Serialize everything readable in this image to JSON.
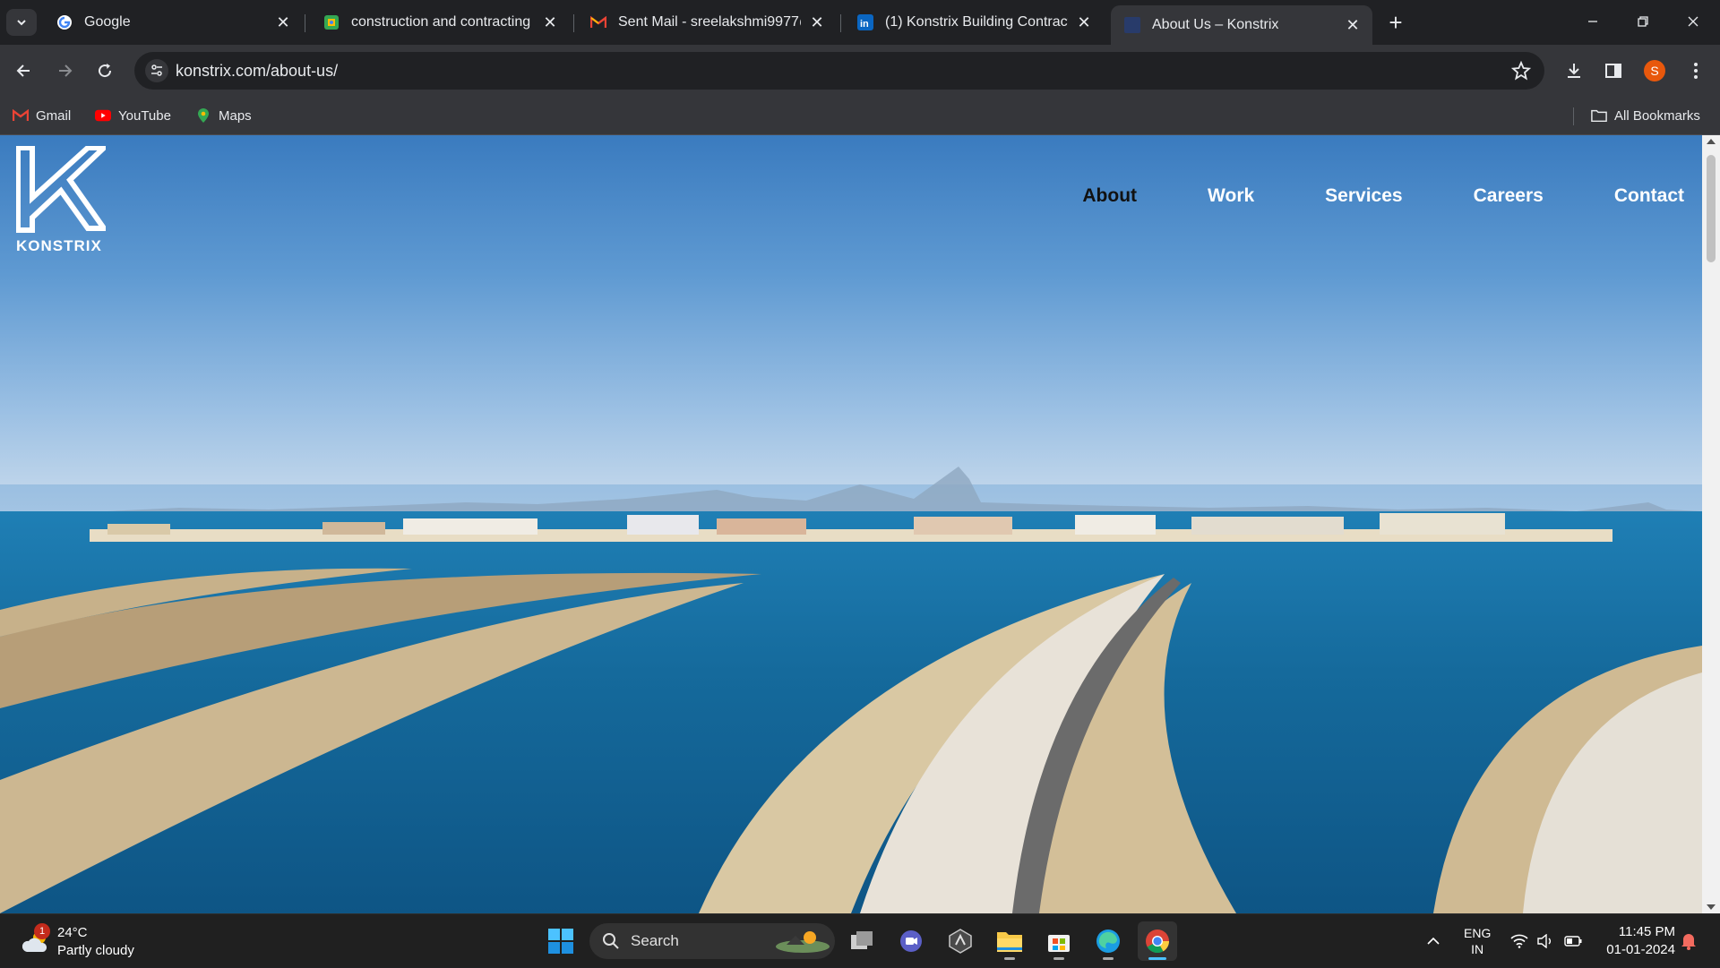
{
  "browser": {
    "tabs": [
      {
        "title": "Google",
        "icon": "google-icon"
      },
      {
        "title": "construction and contracting co",
        "icon": "maps-favicon-icon"
      },
      {
        "title": "Sent Mail - sreelakshmi9977@g",
        "icon": "gmail-icon"
      },
      {
        "title": "(1) Konstrix Building Contractin",
        "icon": "linkedin-icon"
      },
      {
        "title": "About Us – Konstrix",
        "icon": "konstrix-favicon-icon",
        "active": true
      }
    ],
    "url": "konstrix.com/about-us/",
    "profile_initial": "S",
    "bookmarks": [
      {
        "label": "Gmail"
      },
      {
        "label": "YouTube"
      },
      {
        "label": "Maps"
      }
    ],
    "all_bookmarks_label": "All Bookmarks"
  },
  "page": {
    "logo_text": "KONSTRIX",
    "nav": [
      {
        "label": "About",
        "current": true
      },
      {
        "label": "Work"
      },
      {
        "label": "Services"
      },
      {
        "label": "Careers"
      },
      {
        "label": "Contact"
      }
    ]
  },
  "taskbar": {
    "weather_temp": "24°C",
    "weather_condition": "Partly cloudy",
    "weather_badge": "1",
    "search_label": "Search",
    "lang_top": "ENG",
    "lang_bottom": "IN",
    "time": "11:45 PM",
    "date": "01-01-2024"
  },
  "colors": {
    "chrome_dark": "#202124",
    "chrome_toolbar": "#35363a",
    "profile": "#e8580c",
    "nav_current": "#111111"
  }
}
